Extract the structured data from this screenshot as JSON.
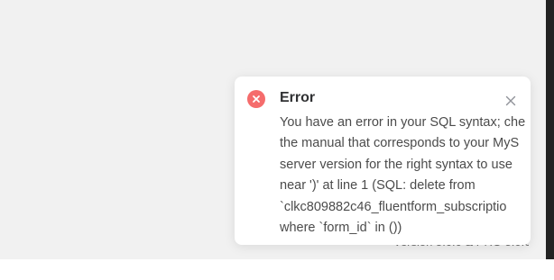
{
  "footer": {
    "version_text": "Version 5.0.0 & PRO 5.0.0"
  },
  "toast": {
    "type": "error",
    "accent_color": "#f56c6c",
    "icon": "error-circle-icon",
    "close_icon": "close-icon",
    "title": "Error",
    "message_lines": [
      "You have an error in your SQL syntax; che",
      "the manual that corresponds to your MyS",
      "server version for the right syntax to use",
      "near ')' at line 1 (SQL: delete from",
      "`clkc809882c46_fluentform_subscriptio",
      "where `form_id` in ())"
    ]
  }
}
